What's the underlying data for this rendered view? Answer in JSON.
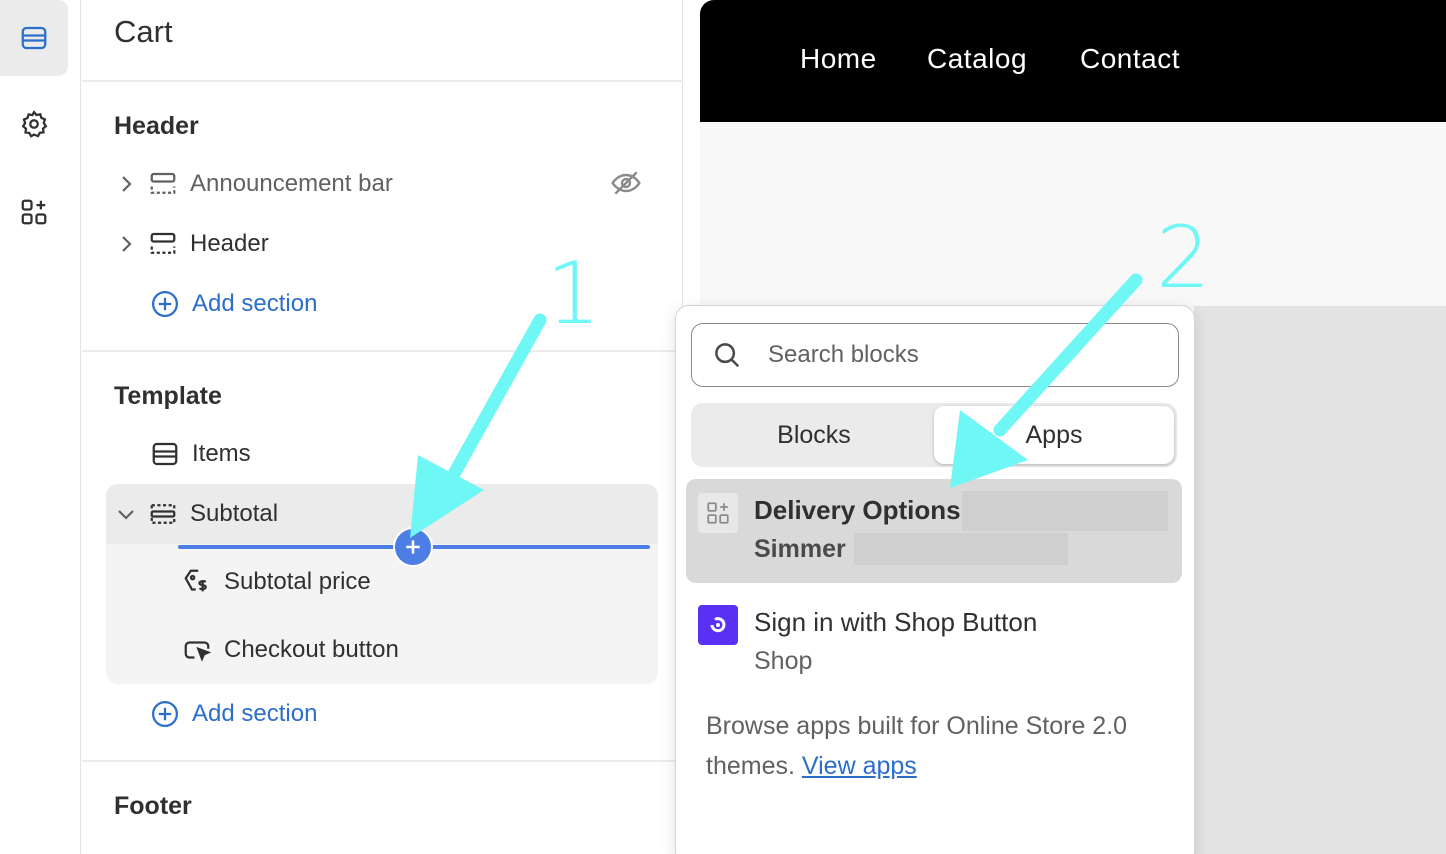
{
  "sidebar": {
    "title": "Cart",
    "header_group": {
      "title": "Header",
      "items": [
        {
          "label": "Announcement bar",
          "hidden": true
        },
        {
          "label": "Header"
        }
      ],
      "add_label": "Add section"
    },
    "template_group": {
      "title": "Template",
      "items": [
        {
          "label": "Items"
        },
        {
          "label": "Subtotal"
        }
      ],
      "children": [
        {
          "label": "Subtotal price"
        },
        {
          "label": "Checkout button"
        }
      ],
      "add_label": "Add section"
    },
    "footer_group": {
      "title": "Footer"
    }
  },
  "preview": {
    "nav": [
      "Home",
      "Catalog",
      "Contact"
    ]
  },
  "popup": {
    "search_placeholder": "Search blocks",
    "tabs": [
      "Blocks",
      "Apps"
    ],
    "active_tab": "Apps",
    "apps": [
      {
        "name": "Delivery Options",
        "developer": "Simmer",
        "selected": true
      },
      {
        "name": "Sign in with Shop Button",
        "developer": "Shop",
        "selected": false
      }
    ],
    "browse_text": "Browse apps built for Online Store 2.0 themes.",
    "browse_link": "View apps"
  },
  "annotations": [
    "1",
    "2"
  ],
  "colors": {
    "accent": "#2c6ecb",
    "insert": "#4c7ee6",
    "annotation": "#6ff7f5",
    "shop_brand": "#5a31f4"
  }
}
